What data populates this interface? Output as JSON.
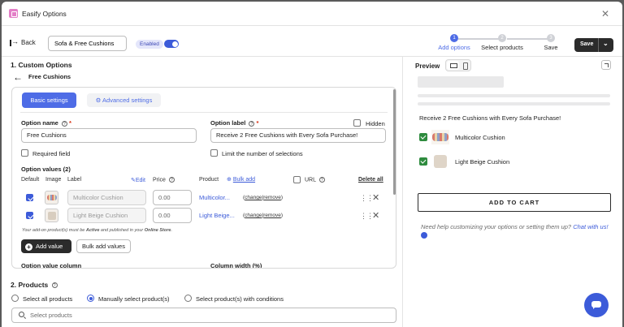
{
  "window": {
    "title": "Easify Options"
  },
  "topbar": {
    "back_label": "Back",
    "option_set_name": "Sofa & Free Cushions",
    "status_badge": "Enabled",
    "steps": [
      {
        "number": "1",
        "label": "Add options"
      },
      {
        "number": "2",
        "label": "Select products"
      },
      {
        "number": "3",
        "label": "Save"
      }
    ],
    "save_label": "Save"
  },
  "custom_options": {
    "section_title": "1. Custom Options",
    "option_title": "Free Cushions",
    "tabs": {
      "basic": "Basic settings",
      "advanced": "Advanced settings"
    },
    "option_name_label": "Option name",
    "option_name_value": "Free Cushions",
    "option_label_label": "Option label",
    "option_label_value": "Receive 2 Free Cushions with Every Sofa Purchase!",
    "hidden_label": "Hidden",
    "required_label": "Required field",
    "limit_label": "Limit the number of selections",
    "values_title": "Option values (2)",
    "columns": {
      "default": "Default",
      "image": "Image",
      "label": "Label",
      "edit": "Edit",
      "price": "Price",
      "product": "Product",
      "bulk_add": "Bulk add",
      "url": "URL",
      "delete_all": "Delete all"
    },
    "rows": [
      {
        "label": "Multicolor Cushion",
        "price": "0.00",
        "product": "Multicolor...",
        "change": "change",
        "remove": "remove"
      },
      {
        "label": "Light Beige Cushion",
        "price": "0.00",
        "product": "Light Beige...",
        "change": "change",
        "remove": "remove"
      }
    ],
    "note_prefix": "Your add-on product(s) must be ",
    "note_active": "Active",
    "note_middle": " and published in your ",
    "note_store": "Online Store",
    "note_suffix": ".",
    "add_value_label": "Add value",
    "bulk_add_values_label": "Bulk add values",
    "value_column_label": "Option value column",
    "column_width_label": "Column width (%)"
  },
  "products": {
    "section_title": "2. Products",
    "radios": [
      "Select all products",
      "Manually select product(s)",
      "Select product(s) with conditions"
    ],
    "search_placeholder": "Select products"
  },
  "preview": {
    "title": "Preview",
    "promo_text": "Receive 2 Free Cushions with Every Sofa Purchase!",
    "options": [
      "Multicolor Cushion",
      "Light Beige Cushion"
    ],
    "add_to_cart": "ADD TO CART",
    "help_text": "Need help customizing your options or setting them up?",
    "help_link": "Chat with us!"
  },
  "colors": {
    "accent": "#4e6ce6",
    "dark": "#2b2b2b",
    "option_check": "#2e8b3e"
  }
}
